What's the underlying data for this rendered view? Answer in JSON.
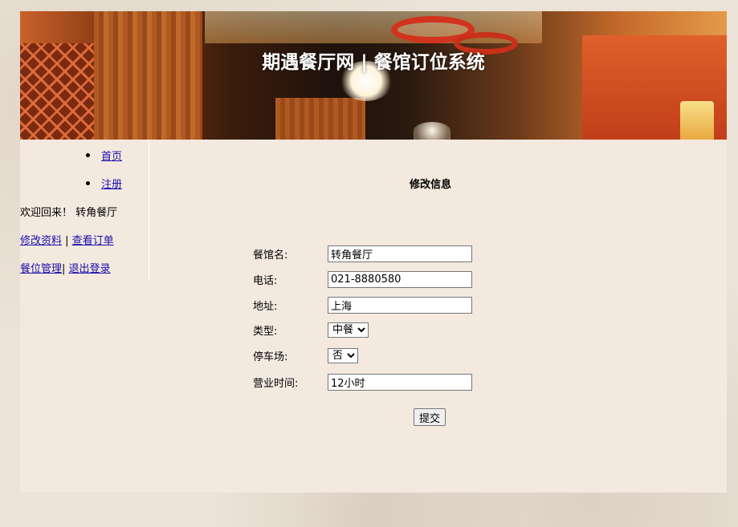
{
  "header": {
    "title": "期遇餐厅网 | 餐馆订位系统"
  },
  "nav": {
    "items": [
      {
        "label": "首页"
      },
      {
        "label": "注册"
      }
    ]
  },
  "sidebar": {
    "welcome": "欢迎回来！ 转角餐厅",
    "edit_profile": "修改资料",
    "separator1": " | ",
    "view_orders": "查看订单",
    "manage_seats": "餐位管理",
    "separator2": "| ",
    "logout": "退出登录"
  },
  "form": {
    "heading": "修改信息",
    "name_label": "餐馆名:",
    "name_value": "转角餐厅",
    "phone_label": "电话:",
    "phone_value": "021-8880580",
    "address_label": "地址:",
    "address_value": "上海",
    "type_label": "类型:",
    "type_selected": "中餐",
    "parking_label": "停车场:",
    "parking_selected": "否",
    "hours_label": "营业时间:",
    "hours_value": "12小时",
    "submit_label": "提交"
  }
}
